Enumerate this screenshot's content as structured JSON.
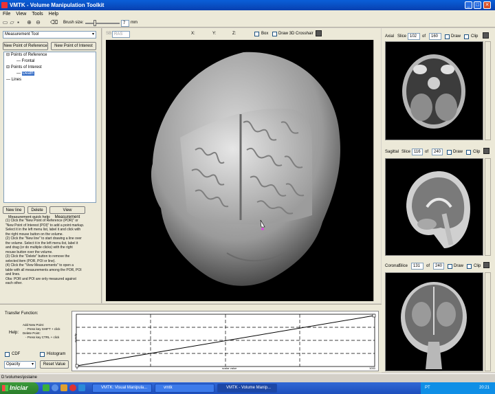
{
  "window": {
    "title": "VMTK - Volume Manipulation Toolkit"
  },
  "menu": [
    "File",
    "View",
    "Tools",
    "Help"
  ],
  "toolbar": {
    "brush_label": "Brush size:",
    "brush_value": "7",
    "brush_unit": "mm"
  },
  "left": {
    "dropdown_value": "Measurement Tool",
    "btn_ref": "New Point of Reference",
    "btn_int": "New Point of Interest",
    "tree": [
      {
        "t": "Points of Reference",
        "l": 0,
        "b": "⊟"
      },
      {
        "t": "Frontal",
        "l": 1,
        "b": ""
      },
      {
        "t": "Points of Interest",
        "l": 0,
        "b": "⊟"
      },
      {
        "t": "Death",
        "l": 1,
        "b": ""
      },
      {
        "t": "Lines",
        "l": 0,
        "b": ""
      }
    ],
    "btn_newline": "New line",
    "btn_delete": "Delete",
    "btn_viewmeas": "View Measurement",
    "help_title": "Measurement quick help:",
    "help": [
      "(1) Click the \"New Point of Reference (POR)\" or",
      "\"New Point of Interest (POI)\" to add a point markup.",
      "Select it in the left menu list, label it and click with",
      "the right mouse button on the volume.",
      "(2) Click the \"New line\" to start drawing a line over",
      "the volume. Select it in the left menu list, label it",
      "and drag (or do multiple clicks) with the right",
      "mouse button over the volume.",
      "(3) Click the \"Delete\" button to remove the",
      "selected item (POR, POI or line).",
      "(4) Click the \"View Measurements\" to open a",
      "table with all measurements among the POR, POI",
      "and lines.",
      "Obs: POR and POI are only measured against",
      "each other."
    ]
  },
  "top": {
    "sb": "SB",
    "sb_value": "RAS",
    "x": "X:",
    "y": "Y:",
    "z": "Z:",
    "box": "Box",
    "draw3d": "Draw 3D Crosshair"
  },
  "slices": [
    {
      "name": "Axial",
      "label": "Slice",
      "value": "102",
      "of": "of",
      "total": "160",
      "draw": "Draw",
      "clip": "Clip"
    },
    {
      "name": "Sagittal",
      "label": "Slice",
      "value": "116",
      "of": "of",
      "total": "240",
      "draw": "Draw",
      "clip": "Clip"
    },
    {
      "name": "Coronal",
      "label": "Slice",
      "value": "131",
      "of": "of",
      "total": "240",
      "draw": "Draw",
      "clip": "Clip"
    }
  ],
  "transfer": {
    "title": "Transfer Function:",
    "help_label": "Help:",
    "help_lines": [
      "Add New Point:",
      "- Press key SHIFT + click",
      "Delete Point:",
      "- Press key CTRL + click"
    ],
    "cdf": "CDF",
    "histogram": "Histogram",
    "opacity_value": "Opacity",
    "reset": "Reset Value",
    "xlabel": "scalar value",
    "ylabel": "opacity",
    "xmin": "0",
    "xmax": "1000"
  },
  "status": "D:\\volumes\\joslaine",
  "taskbar": {
    "start": "Iniciar",
    "tasks": [
      "VMTK: Visual Manipula...",
      "vmtk",
      "VMTK - Volume Manip..."
    ],
    "lang": "PT",
    "clock": "20:21"
  }
}
